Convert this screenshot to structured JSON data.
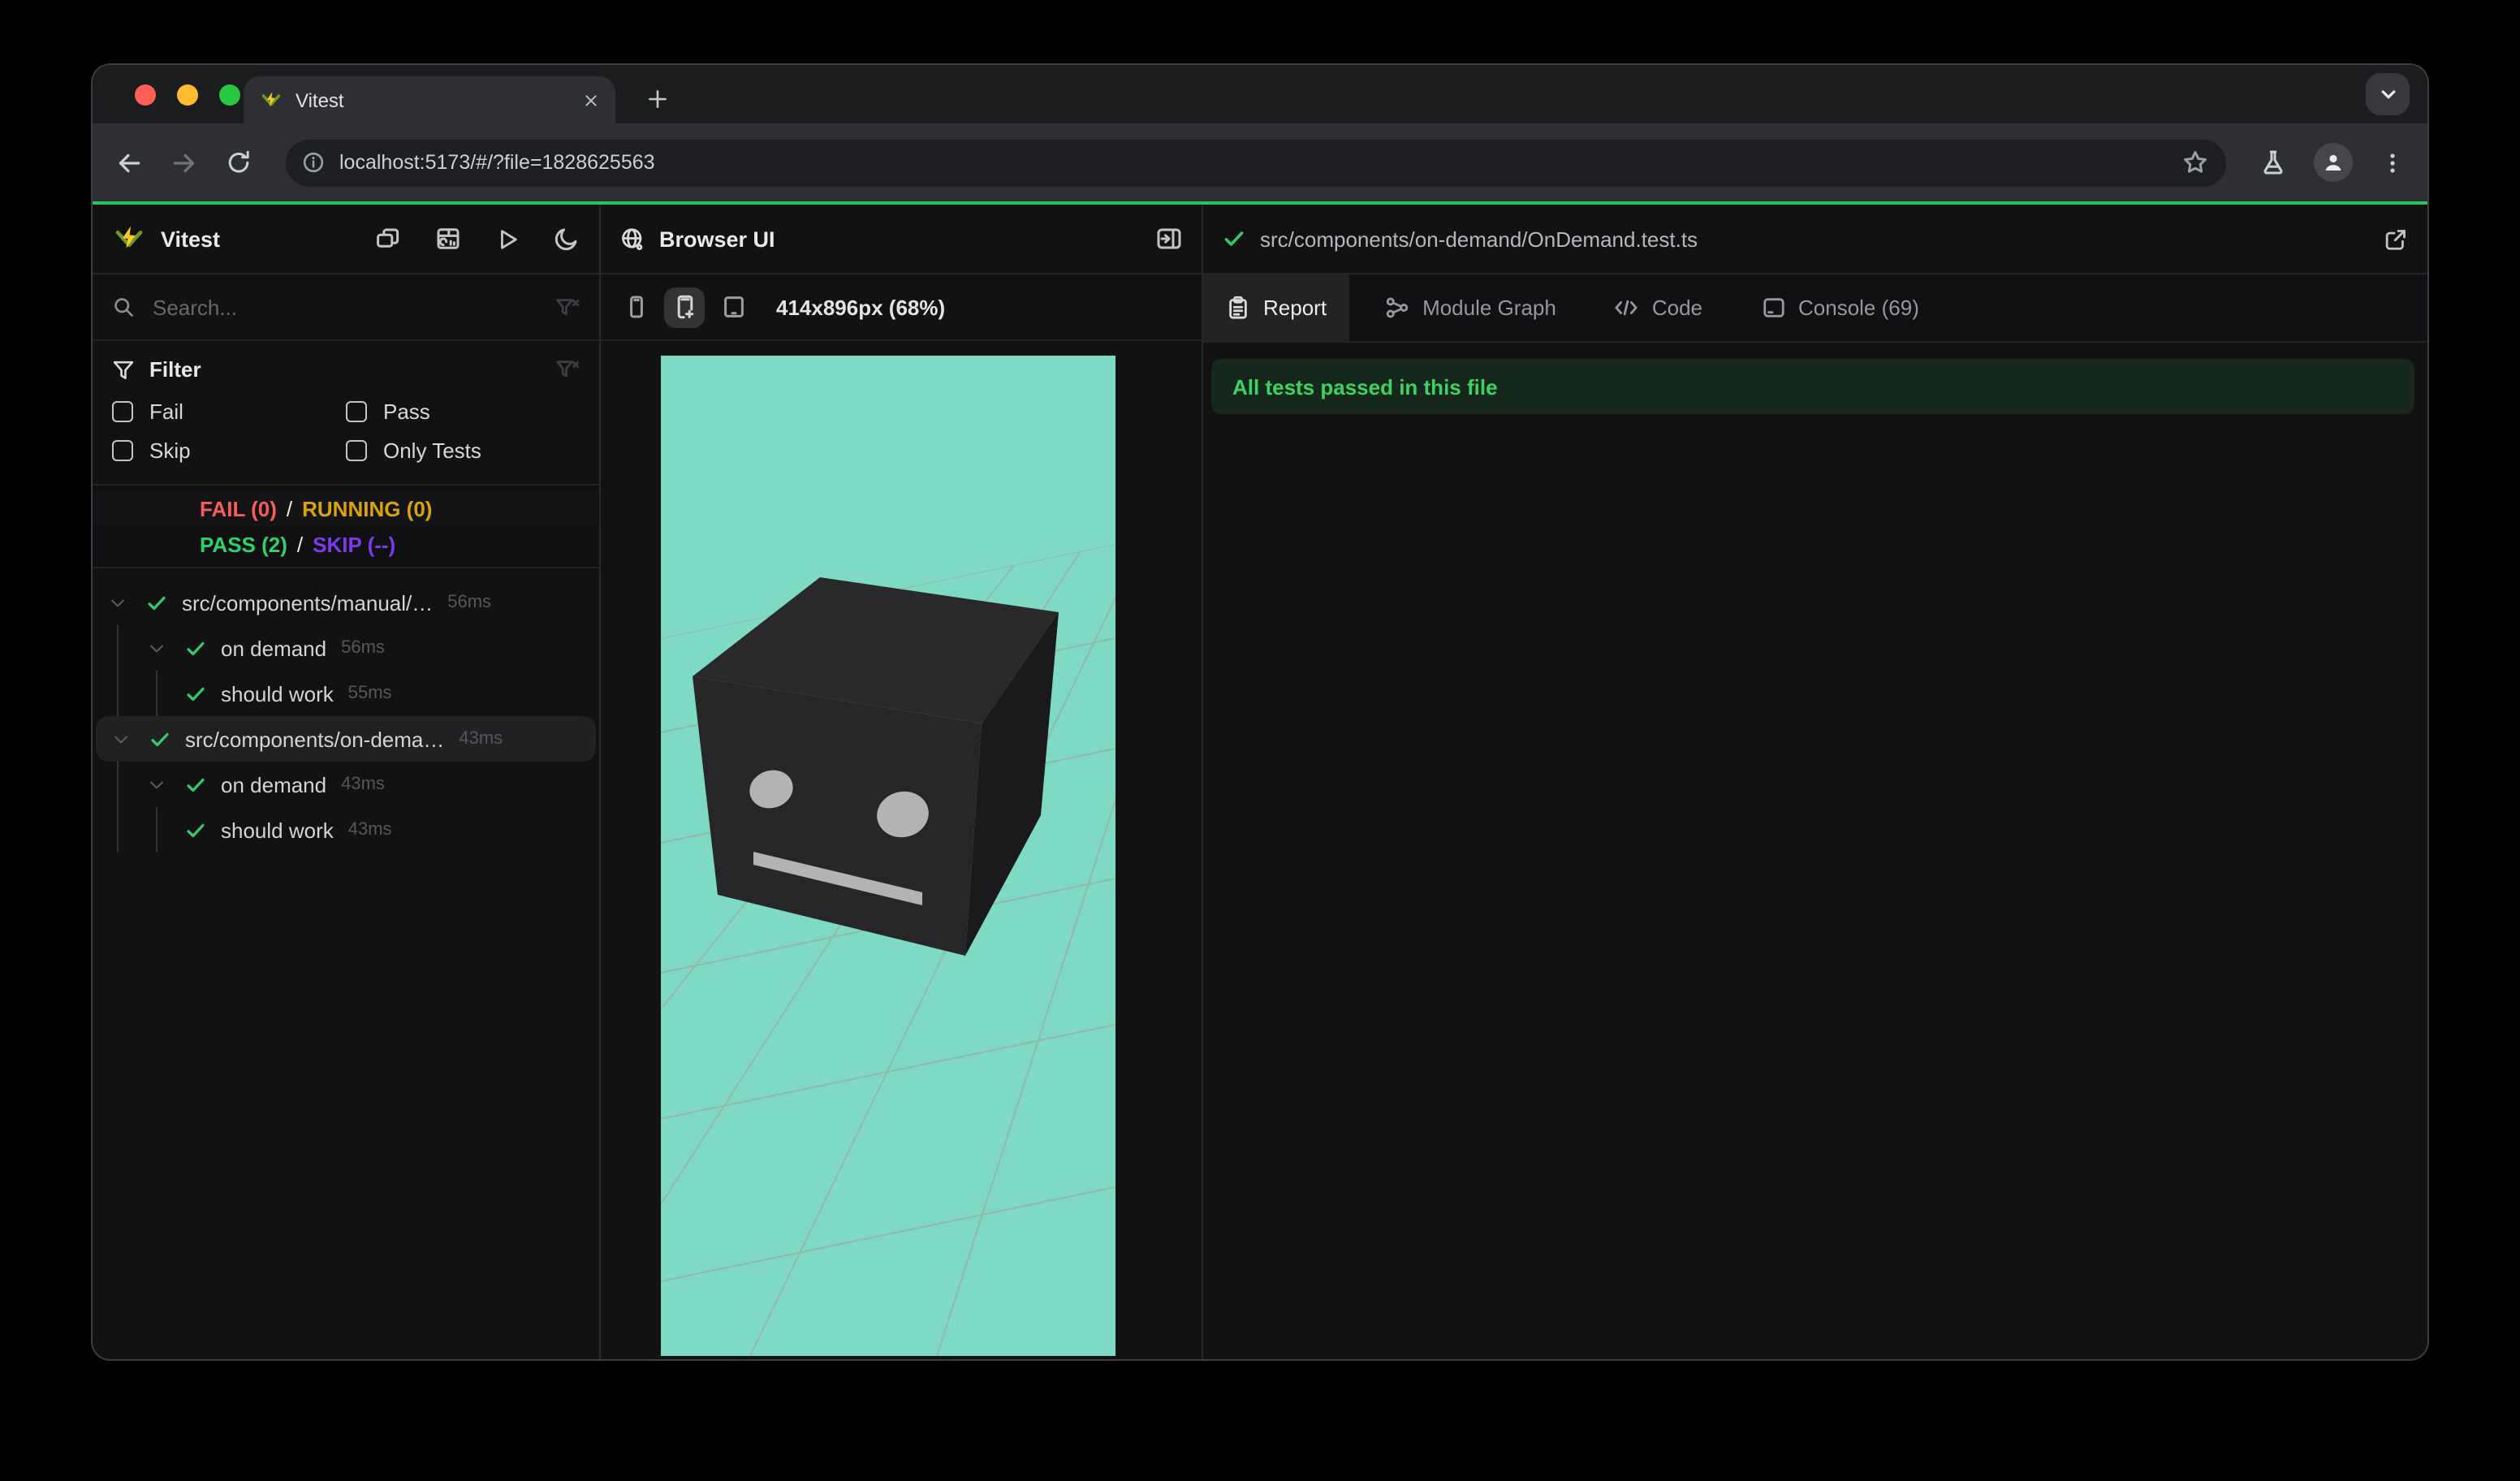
{
  "colors": {
    "accent_green": "#23c55e",
    "fail_red": "#f65e5e",
    "running_yellow": "#d9a40a",
    "pass_green": "#2fd26a",
    "skip_purple": "#7c3aed",
    "check_green": "#35ca6b",
    "banner_bg": "#16281c",
    "banner_text": "#3ed163",
    "canvas_teal": "#7edac3",
    "grid_line": "#9fa9a5",
    "cube_top": "#29292b",
    "cube_front": "#262628",
    "cube_side": "#1a1a1c",
    "cube_face_gray": "#b3b3b3"
  },
  "browser": {
    "tab_title": "Vitest",
    "url": "localhost:5173/#/?file=1828625563"
  },
  "sidebar": {
    "app_name": "Vitest",
    "search_placeholder": "Search...",
    "filter": {
      "title": "Filter",
      "options": [
        "Fail",
        "Pass",
        "Skip",
        "Only Tests"
      ]
    },
    "summary": {
      "fail": "FAIL (0)",
      "running": "RUNNING (0)",
      "pass": "PASS (2)",
      "skip": "SKIP (--)",
      "sep": "/"
    },
    "tree": [
      {
        "label": "src/components/manual/…",
        "duration": "56ms"
      },
      {
        "label": "on demand",
        "duration": "56ms"
      },
      {
        "label": "should work",
        "duration": "55ms"
      },
      {
        "label": "src/components/on-dema…",
        "duration": "43ms"
      },
      {
        "label": "on demand",
        "duration": "43ms"
      },
      {
        "label": "should work",
        "duration": "43ms"
      }
    ]
  },
  "browser_panel": {
    "title": "Browser UI",
    "viewport": "414x896px (68%)"
  },
  "report_panel": {
    "file_path": "src/components/on-demand/OnDemand.test.ts",
    "tabs": [
      {
        "label": "Report"
      },
      {
        "label": "Module Graph"
      },
      {
        "label": "Code"
      },
      {
        "label": "Console (69)"
      }
    ],
    "banner": "All tests passed in this file"
  }
}
